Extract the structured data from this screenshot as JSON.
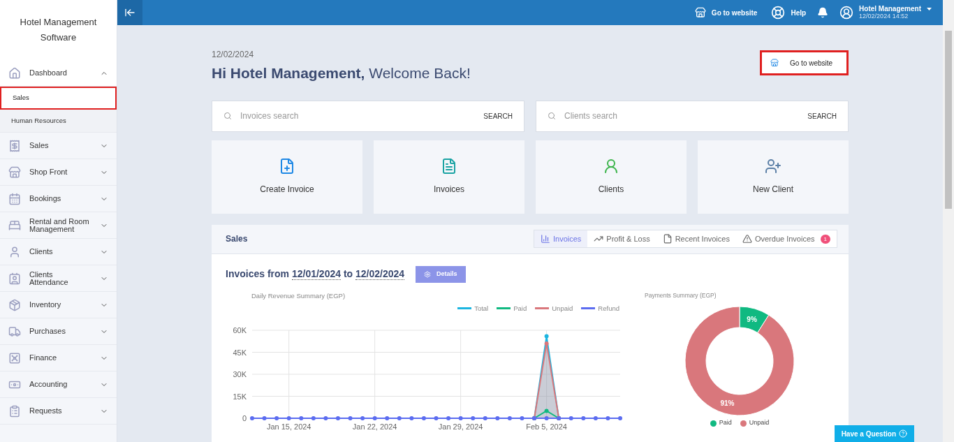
{
  "sidebar": {
    "title": "Hotel Management Software",
    "items": [
      {
        "label": "Dashboard",
        "expanded": true,
        "children": [
          {
            "label": "Sales",
            "selected": true,
            "highlighted": true
          },
          {
            "label": "Human Resources",
            "selected": false,
            "highlighted": false
          }
        ]
      },
      {
        "label": "Sales",
        "expanded": false
      },
      {
        "label": "Shop Front",
        "expanded": false
      },
      {
        "label": "Bookings",
        "expanded": false
      },
      {
        "label": "Rental and Room Management",
        "expanded": false
      },
      {
        "label": "Clients",
        "expanded": false
      },
      {
        "label": "Clients Attendance",
        "expanded": false
      },
      {
        "label": "Inventory",
        "expanded": false
      },
      {
        "label": "Purchases",
        "expanded": false
      },
      {
        "label": "Finance",
        "expanded": false
      },
      {
        "label": "Accounting",
        "expanded": false
      },
      {
        "label": "Requests",
        "expanded": false
      }
    ]
  },
  "topbar": {
    "website": "Go to website",
    "help": "Help",
    "user": "Hotel Management",
    "datetime": "12/02/2024 14:52"
  },
  "header": {
    "date": "12/02/2024",
    "greeting": "Hi Hotel Management,",
    "welcome": "Welcome Back!",
    "website_button": {
      "label": "Go to website",
      "highlighted": true
    }
  },
  "searches": [
    {
      "placeholder": "Invoices search",
      "button": "SEARCH"
    },
    {
      "placeholder": "Clients search",
      "button": "SEARCH"
    }
  ],
  "actions": [
    {
      "label": "Create Invoice"
    },
    {
      "label": "Invoices"
    },
    {
      "label": "Clients"
    },
    {
      "label": "New Client"
    }
  ],
  "sales": {
    "title": "Sales",
    "tabs": [
      {
        "label": "Invoices",
        "selected": true
      },
      {
        "label": "Profit & Loss",
        "selected": false
      },
      {
        "label": "Recent Invoices",
        "selected": false
      },
      {
        "label": "Overdue Invoices",
        "selected": false,
        "badge": "1"
      }
    ],
    "range_label": "Invoices from",
    "from": "12/01/2024",
    "to_label": "to",
    "to": "12/02/2024",
    "details": "Details",
    "line_chart": {
      "chart_data": {
        "type": "line",
        "title": "Daily Revenue Summary (EGP)",
        "grid": true,
        "categories": [
          null,
          null,
          null,
          "Jan 15, 2024",
          null,
          null,
          null,
          null,
          null,
          null,
          "Jan 22, 2024",
          null,
          null,
          null,
          null,
          null,
          null,
          "Jan 29, 2024",
          null,
          null,
          null,
          null,
          null,
          null,
          "Feb 5, 2024",
          null,
          null,
          null,
          null,
          null,
          null
        ],
        "series": [
          {
            "name": "Total",
            "color": "#1cb5e0",
            "marker": true,
            "values": [
              null,
              null,
              null,
              null,
              null,
              null,
              null,
              null,
              null,
              null,
              null,
              null,
              null,
              null,
              null,
              null,
              null,
              null,
              null,
              null,
              null,
              null,
              null,
              0,
              56000,
              0,
              null,
              null,
              null,
              null,
              null
            ]
          },
          {
            "name": "Paid",
            "color": "#10b981",
            "marker": true,
            "values": [
              null,
              null,
              null,
              null,
              null,
              null,
              null,
              null,
              null,
              null,
              null,
              null,
              null,
              null,
              null,
              null,
              null,
              null,
              null,
              null,
              null,
              null,
              null,
              0,
              5000,
              0,
              null,
              null,
              null,
              null,
              null
            ]
          },
          {
            "name": "Unpaid",
            "color": "#d9777c",
            "marker": true,
            "values": [
              null,
              null,
              null,
              null,
              null,
              null,
              null,
              null,
              null,
              null,
              null,
              null,
              null,
              null,
              null,
              null,
              null,
              null,
              null,
              null,
              null,
              null,
              null,
              0,
              51000,
              0,
              null,
              null,
              null,
              null,
              null
            ]
          },
          {
            "name": "Refund",
            "color": "#5b6cf0",
            "marker": true,
            "values": [
              0,
              0,
              0,
              0,
              0,
              0,
              0,
              0,
              0,
              0,
              0,
              0,
              0,
              0,
              0,
              0,
              0,
              0,
              0,
              0,
              0,
              0,
              0,
              0,
              0,
              0,
              0,
              0,
              0,
              0,
              0
            ]
          }
        ],
        "ylim": [
          0,
          60000
        ],
        "yticks": [
          {
            "value": 0,
            "label": "0"
          },
          {
            "value": 15000,
            "label": "15K"
          },
          {
            "value": 30000,
            "label": "30K"
          },
          {
            "value": 45000,
            "label": "45K"
          },
          {
            "value": 60000,
            "label": "60K"
          }
        ]
      }
    },
    "donut": {
      "chart_data": {
        "type": "donut",
        "title": "Payments Summary (EGP)",
        "categories": [
          "Paid",
          "Unpaid"
        ],
        "series": [
          {
            "values": [
              9,
              91
            ]
          }
        ],
        "value_labels": [
          "9%",
          "91%"
        ]
      }
    }
  },
  "help_button": "Have a Question"
}
